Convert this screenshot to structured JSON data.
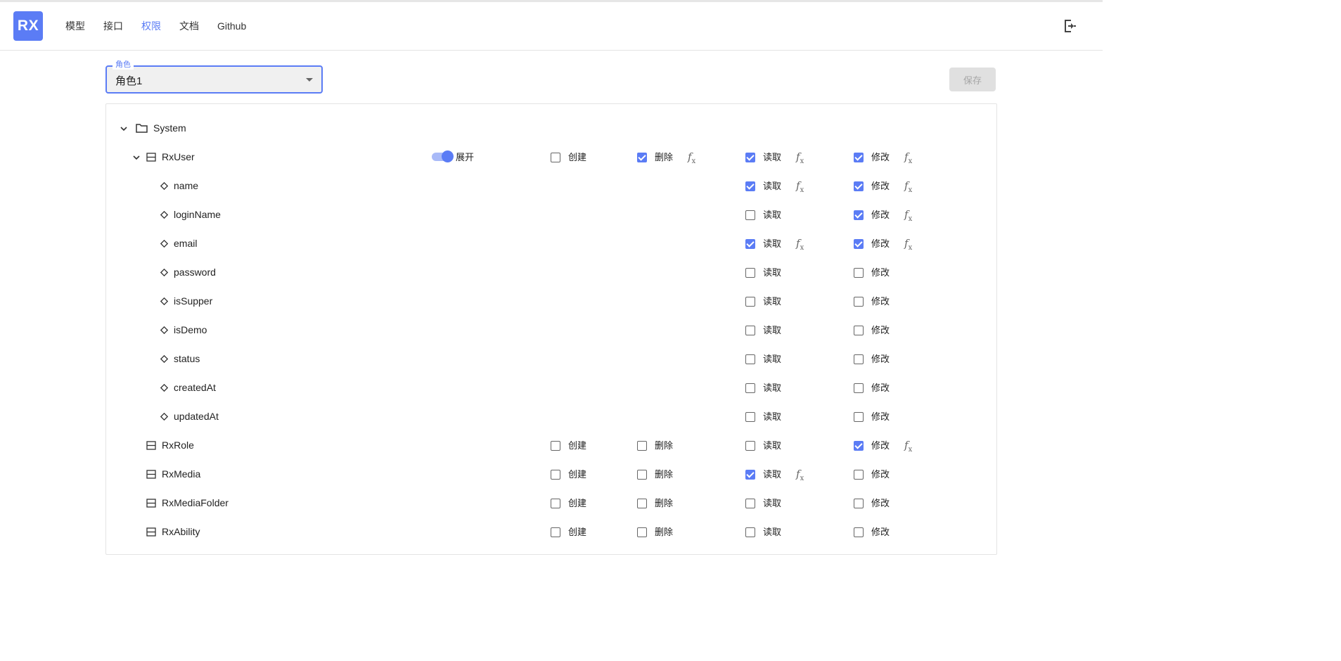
{
  "logo": "RX",
  "nav": [
    "模型",
    "接口",
    "权限",
    "文档",
    "Github"
  ],
  "nav_active_index": 2,
  "role": {
    "legend": "角色",
    "value": "角色1"
  },
  "save_label": "保存",
  "labels": {
    "create": "创建",
    "delete": "删除",
    "read": "读取",
    "update": "修改",
    "expand": "展开"
  },
  "tree": {
    "package": "System",
    "entities": [
      {
        "name": "RxUser",
        "expanded": true,
        "expand_toggle": true,
        "create": false,
        "delete": true,
        "delete_fx": true,
        "read": true,
        "read_fx": true,
        "update": true,
        "update_fx": true,
        "columns": [
          {
            "name": "name",
            "read": true,
            "read_fx": true,
            "update": true,
            "update_fx": true
          },
          {
            "name": "loginName",
            "read": false,
            "read_fx": false,
            "update": true,
            "update_fx": true
          },
          {
            "name": "email",
            "read": true,
            "read_fx": true,
            "update": true,
            "update_fx": true
          },
          {
            "name": "password",
            "read": false,
            "read_fx": false,
            "update": false,
            "update_fx": false
          },
          {
            "name": "isSupper",
            "read": false,
            "read_fx": false,
            "update": false,
            "update_fx": false
          },
          {
            "name": "isDemo",
            "read": false,
            "read_fx": false,
            "update": false,
            "update_fx": false
          },
          {
            "name": "status",
            "read": false,
            "read_fx": false,
            "update": false,
            "update_fx": false
          },
          {
            "name": "createdAt",
            "read": false,
            "read_fx": false,
            "update": false,
            "update_fx": false
          },
          {
            "name": "updatedAt",
            "read": false,
            "read_fx": false,
            "update": false,
            "update_fx": false
          }
        ]
      },
      {
        "name": "RxRole",
        "create": false,
        "delete": false,
        "delete_fx": false,
        "read": false,
        "read_fx": false,
        "update": true,
        "update_fx": true
      },
      {
        "name": "RxMedia",
        "create": false,
        "delete": false,
        "delete_fx": false,
        "read": true,
        "read_fx": true,
        "update": false,
        "update_fx": false
      },
      {
        "name": "RxMediaFolder",
        "create": false,
        "delete": false,
        "delete_fx": false,
        "read": false,
        "read_fx": false,
        "update": false,
        "update_fx": false
      },
      {
        "name": "RxAbility",
        "create": false,
        "delete": false,
        "delete_fx": false,
        "read": false,
        "read_fx": false,
        "update": false,
        "update_fx": false
      }
    ]
  },
  "colors": {
    "accent": "#5b7cf5",
    "accent_light": "#a9baf8",
    "disabled_bg": "#e0e0e0",
    "border": "#e4e4e4"
  },
  "icons": {
    "logout": "logout-icon",
    "folder": "folder-icon",
    "table": "table-icon",
    "field": "diamond-icon",
    "chevron": "chevron-down-icon",
    "formula": "fx-icon"
  }
}
